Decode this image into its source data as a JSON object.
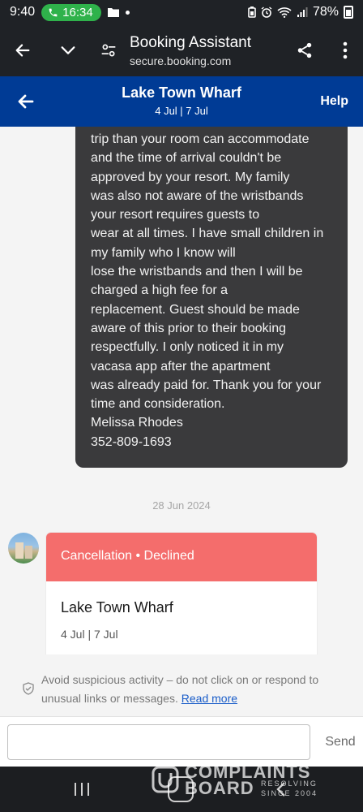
{
  "status_bar": {
    "time": "9:40",
    "call_timer": "16:34",
    "battery": "78%",
    "icons": [
      "phone-icon",
      "folder-icon",
      "dot-icon",
      "battery-saver-icon",
      "alarm-icon",
      "wifi-icon",
      "signal-icon",
      "battery-icon"
    ]
  },
  "browser": {
    "title": "Booking Assistant",
    "url": "secure.booking.com",
    "icons": [
      "back-arrow-icon",
      "chevron-down-icon",
      "tune-icon",
      "share-icon",
      "more-vert-icon"
    ]
  },
  "header": {
    "title": "Lake Town Wharf",
    "dates": "4 Jul | 7 Jul",
    "help_label": "Help"
  },
  "message": {
    "lines": [
      "trip than your room can accommodate",
      "and the time of arrival couldn't be",
      "approved by your resort. My family",
      "was also not aware of the wristbands",
      "your resort requires guests to",
      "wear at all times. I have small children in",
      "my family who I know will",
      "lose the wristbands and then I will be",
      "charged a high fee for a",
      "replacement. Guest should be made",
      "aware of this prior to their booking",
      "respectfully. I only noticed it in my",
      "vacasa app after the apartment",
      "was already paid for. Thank you for your",
      "time and consideration.",
      "Melissa Rhodes",
      "352-809-1693"
    ]
  },
  "date_separator": "28 Jun 2024",
  "card": {
    "status": "Cancellation • Declined",
    "status_color": "#f46d6c",
    "title": "Lake Town Wharf",
    "subtitle": "4 Jul | 7 Jul"
  },
  "warning": {
    "text": "Avoid suspicious activity – do not click on or respond to unusual links or messages.",
    "link": "Read more"
  },
  "composer": {
    "placeholder": "",
    "send_label": "Send"
  },
  "watermark": {
    "line1": "COMPLAINTS",
    "line2": "BOARD",
    "tagline_1": "RESOLVING",
    "tagline_2": "SINCE 2004"
  },
  "colors": {
    "header_bg": "#003b95",
    "bubble_bg": "#3a3a3c",
    "status_declined": "#f46d6c",
    "link": "#1a5dc9"
  }
}
